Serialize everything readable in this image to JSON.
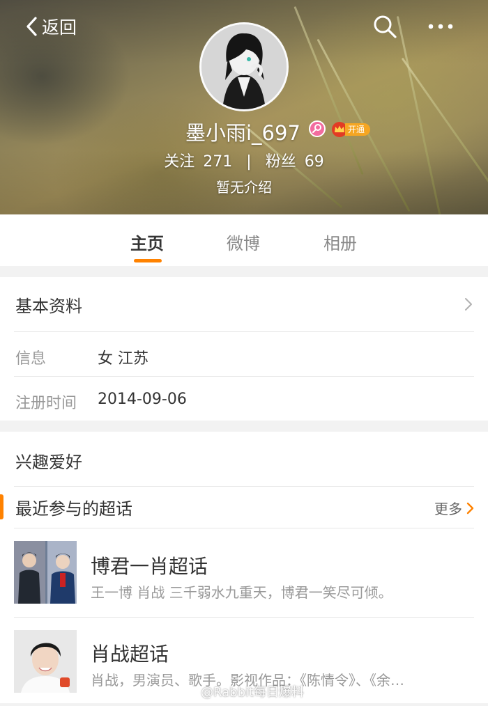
{
  "header": {
    "back_label": "返回",
    "nickname": "墨小雨i_697",
    "vip_label": "开通",
    "following_label": "关注",
    "following_count": "271",
    "stats_separator": "|",
    "followers_label": "粉丝",
    "followers_count": "69",
    "bio": "暂无介绍"
  },
  "tabs": [
    {
      "label": "主页",
      "active": true
    },
    {
      "label": "微博",
      "active": false
    },
    {
      "label": "相册",
      "active": false
    }
  ],
  "basic_info": {
    "title": "基本资料",
    "rows": [
      {
        "label": "信息",
        "value": "女  江苏"
      },
      {
        "label": "注册时间",
        "value": "2014-09-06"
      }
    ]
  },
  "interests": {
    "title": "兴趣爱好",
    "section_title": "最近参与的超话",
    "more_label": "更多",
    "topics": [
      {
        "name": "博君一肖超话",
        "desc": "王一博 肖战  三千弱水九重天，博君一笑尽可倾。"
      },
      {
        "name": "肖战超话",
        "desc": "肖战，男演员、歌手。影视作品：《陈情令》、《余…"
      }
    ]
  },
  "watermark": "@Rabbit每日爆料",
  "colors": {
    "accent": "#ff8200",
    "gender_badge": "#f26c9f",
    "vip_badge": "#f5a623"
  }
}
